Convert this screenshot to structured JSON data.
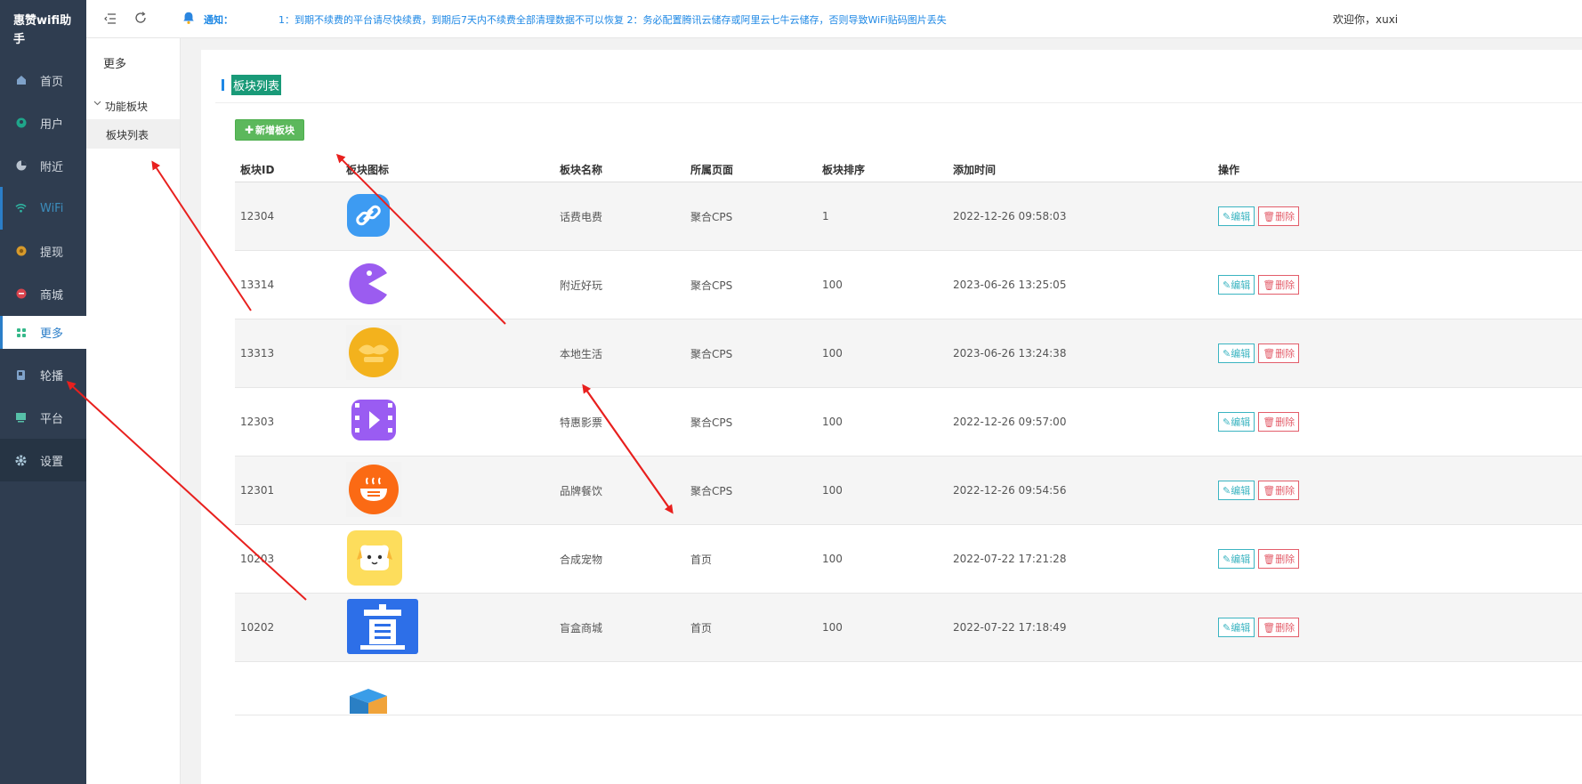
{
  "brand": {
    "line1": "惠赞wifi助",
    "line2": "手"
  },
  "sidebar": {
    "items": [
      {
        "label": "首页",
        "icon": "home-icon"
      },
      {
        "label": "用户",
        "icon": "user-icon"
      },
      {
        "label": "附近",
        "icon": "nearby-icon"
      },
      {
        "label": "WiFi",
        "icon": "wifi-icon"
      },
      {
        "label": "提现",
        "icon": "withdraw-icon"
      },
      {
        "label": "商城",
        "icon": "shop-icon"
      },
      {
        "label": "更多",
        "icon": "grid-icon"
      },
      {
        "label": "轮播",
        "icon": "carousel-icon"
      },
      {
        "label": "平台",
        "icon": "platform-icon"
      },
      {
        "label": "设置",
        "icon": "gear-icon"
      }
    ],
    "active": "更多"
  },
  "submenu": {
    "title": "更多",
    "group": "功能板块",
    "item": "板块列表"
  },
  "topbar": {
    "notice_label": "通知：",
    "notice_text": "1：到期不续费的平台请尽快续费，到期后7天内不续费全部清理数据不可以恢复 2：务必配置腾讯云储存或阿里云七牛云储存，否则导致WiFi贴码图片丢失",
    "welcome": "欢迎你，xuxi"
  },
  "panel": {
    "title": "板块列表",
    "add_button": "新增板块"
  },
  "table": {
    "headers": {
      "id": "板块ID",
      "icon": "板块图标",
      "name": "板块名称",
      "page": "所属页面",
      "sort": "板块排序",
      "time": "添加时间",
      "op": "操作"
    },
    "edit_label": "编辑",
    "delete_label": "删除",
    "rows": [
      {
        "id": "12304",
        "name": "话费电费",
        "page": "聚合CPS",
        "sort": "1",
        "time": "2022-12-26 09:58:03",
        "icon": "link-icon"
      },
      {
        "id": "13314",
        "name": "附近好玩",
        "page": "聚合CPS",
        "sort": "100",
        "time": "2023-06-26 13:25:05",
        "icon": "pacman-icon"
      },
      {
        "id": "13313",
        "name": "本地生活",
        "page": "聚合CPS",
        "sort": "100",
        "time": "2023-06-26 13:24:38",
        "icon": "local-life-icon"
      },
      {
        "id": "12303",
        "name": "特惠影票",
        "page": "聚合CPS",
        "sort": "100",
        "time": "2022-12-26 09:57:00",
        "icon": "video-icon"
      },
      {
        "id": "12301",
        "name": "品牌餐饮",
        "page": "聚合CPS",
        "sort": "100",
        "time": "2022-12-26 09:54:56",
        "icon": "bowl-icon"
      },
      {
        "id": "10203",
        "name": "合成宠物",
        "page": "首页",
        "sort": "100",
        "time": "2022-07-22 17:21:28",
        "icon": "pet-icon"
      },
      {
        "id": "10202",
        "name": "盲盒商城",
        "page": "首页",
        "sort": "100",
        "time": "2022-07-22 17:18:49",
        "icon": "blindbox-icon"
      }
    ]
  },
  "colors": {
    "sidebar_bg": "#2f3d50",
    "accent": "#1e88e5",
    "add_btn": "#5cb85c",
    "edit": "#3bb4c1",
    "delete": "#e35d6a",
    "annotation": "#e8201e"
  }
}
